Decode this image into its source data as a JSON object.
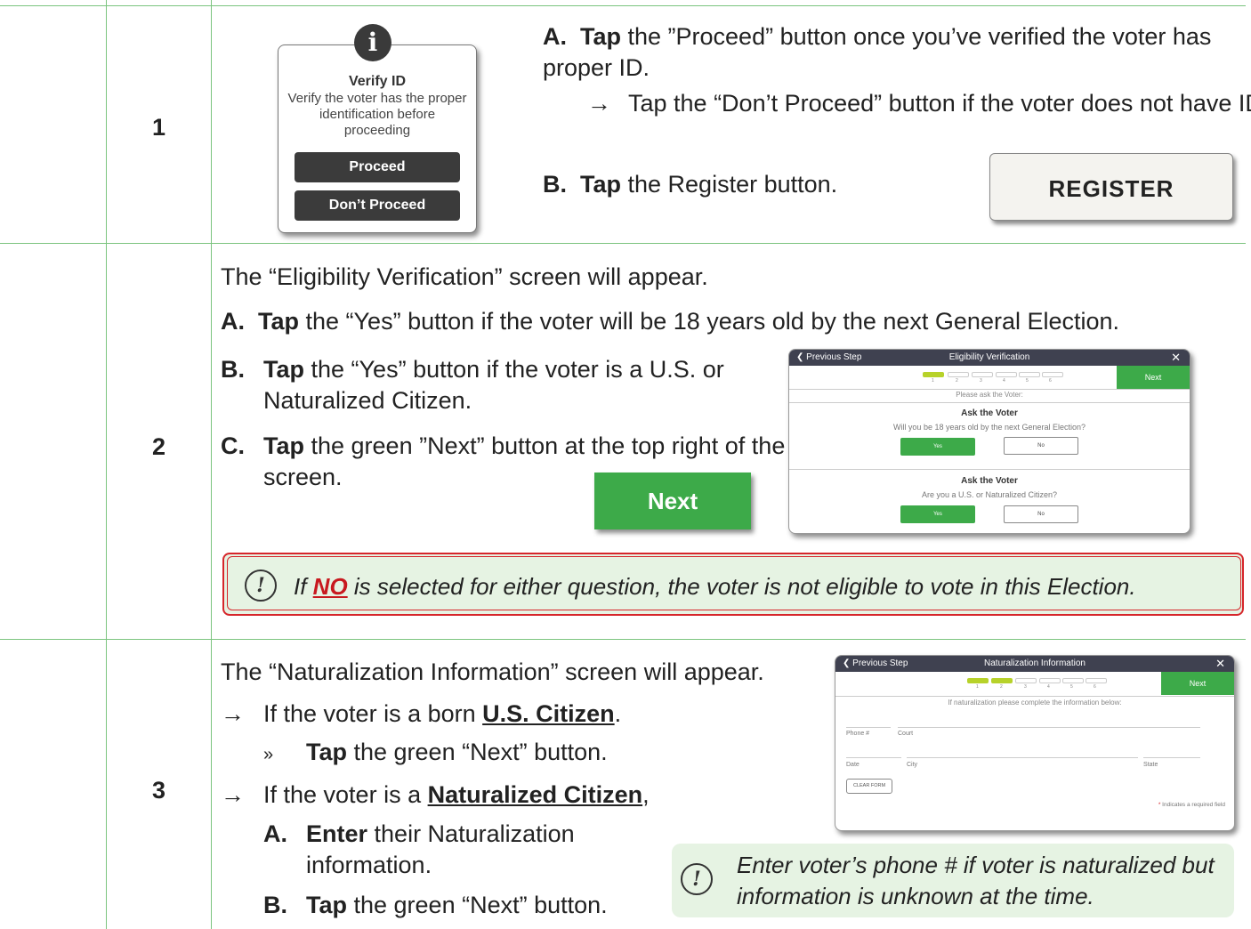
{
  "steps": [
    {
      "number": "1"
    },
    {
      "number": "2"
    },
    {
      "number": "3"
    }
  ],
  "step1": {
    "popup": {
      "title": "Verify ID",
      "body": "Verify the voter has the proper identification before proceeding",
      "proceed": "Proceed",
      "dont_proceed": "Don’t Proceed"
    },
    "a_label": "A.",
    "a_verb": "Tap",
    "a_text": " the ”Proceed” button once you’ve verified the voter has proper ID.",
    "arrow": "→",
    "arrow_text": "Tap the “Don’t Proceed” button if the voter does not have ID.",
    "b_label": "B.",
    "b_verb": "Tap",
    "b_text": " the Register button.",
    "register_button": "REGISTER"
  },
  "step2": {
    "intro": "The “Eligibility Verification” screen will appear.",
    "a_label": "A.",
    "a_verb": "Tap",
    "a_text": " the “Yes” button if the voter will be 18 years old by the next General Election.",
    "b_label": "B.",
    "b_verb": "Tap",
    "b_text": " the “Yes” button if the voter is a U.S. or Naturalized Citizen.",
    "c_label": "C.",
    "c_verb": "Tap",
    "c_text": " the green ”Next” button at the top right of the screen.",
    "next_button": "Next",
    "screen": {
      "prev": "Previous Step",
      "title": "Eligibility Verification",
      "close": "✕",
      "next": "Next",
      "progress": [
        "1",
        "2",
        "3",
        "4",
        "5",
        "6"
      ],
      "prompt": "Please ask the Voter:",
      "q1_head": "Ask the Voter",
      "q1": "Will you be 18 years old by the next General Election?",
      "q2_head": "Ask the Voter",
      "q2": "Are you a U.S. or Naturalized Citizen?",
      "yes": "Yes",
      "no": "No"
    },
    "warning_pre": "If ",
    "warning_no": "NO",
    "warning_post": " is selected for either question, the voter is not eligible to vote in this Election."
  },
  "step3": {
    "intro": "The “Naturalization Information” screen will appear.",
    "arrow": "→",
    "born_pre": "If the voter is a born ",
    "born_em": "U.S. Citizen",
    "born_post": ".",
    "bullet": "»",
    "born_verb": "Tap",
    "born_action": " the green “Next” button.",
    "nat_pre": "If the voter is a ",
    "nat_em": "Naturalized Citizen",
    "nat_post": ",",
    "a_label": "A.",
    "a_verb": "Enter",
    "a_text": " their Naturalization information.",
    "b_label": "B.",
    "b_verb": "Tap",
    "b_text": " the green “Next” button.",
    "screen": {
      "prev": "Previous Step",
      "title": "Naturalization Information",
      "close": "✕",
      "next": "Next",
      "progress": [
        "1",
        "2",
        "3",
        "4",
        "5",
        "6"
      ],
      "prompt": "If naturalization please complete the information below:",
      "phone": "Phone #",
      "court": "Court",
      "date": "Date",
      "city": "City",
      "state": "State",
      "clear": "CLEAR FORM",
      "required_star": "*",
      "required": " Indicates a required field"
    },
    "note": "Enter voter’s phone # if voter is naturalized but information is unknown at the time."
  },
  "colors": {
    "green": "#3daa49",
    "rule": "#7bc47f",
    "red": "#d6262b",
    "note_bg": "#e6f3e3"
  }
}
